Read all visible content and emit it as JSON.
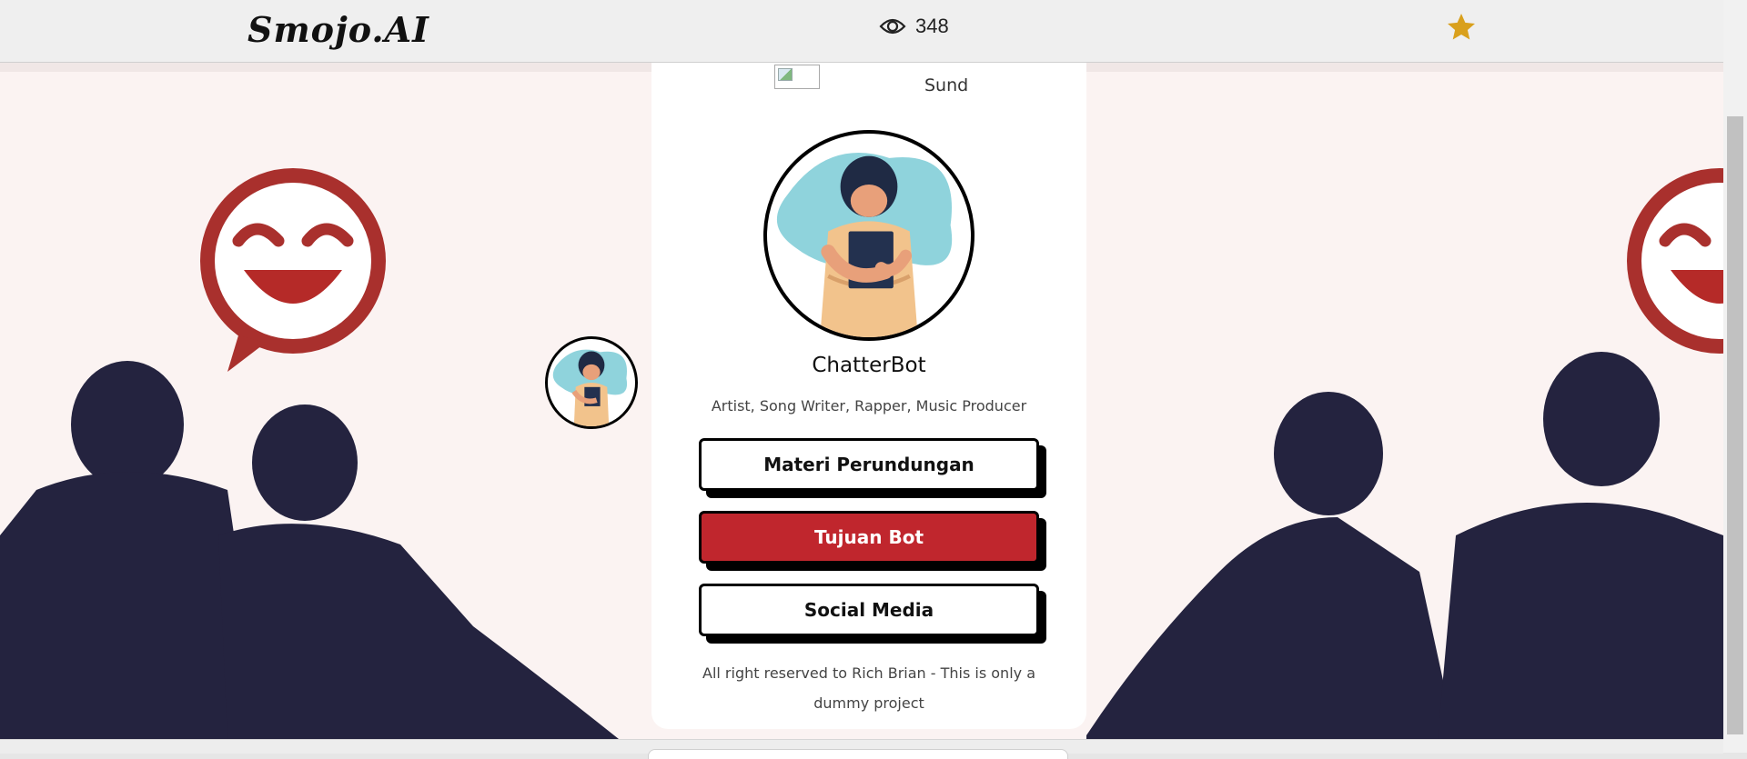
{
  "header": {
    "logo_text": "Smojo.AI",
    "view_count": "348"
  },
  "card": {
    "top_text": "Sund",
    "bot_name": "ChatterBot",
    "subtitle": "Artist, Song Writer, Rapper, Music Producer",
    "buttons": [
      {
        "label": "Materi Perundungan",
        "style": "white"
      },
      {
        "label": "Tujuan Bot",
        "style": "red"
      },
      {
        "label": "Social Media",
        "style": "white"
      }
    ],
    "footer": "All right reserved to Rich Brian - This is only a dummy project"
  },
  "icons": {
    "views": "eye-icon",
    "favorite": "star-icon"
  },
  "colors": {
    "accent_red": "#c0262d",
    "star_gold": "#d9a01c",
    "silhouette_navy": "#24233f"
  }
}
